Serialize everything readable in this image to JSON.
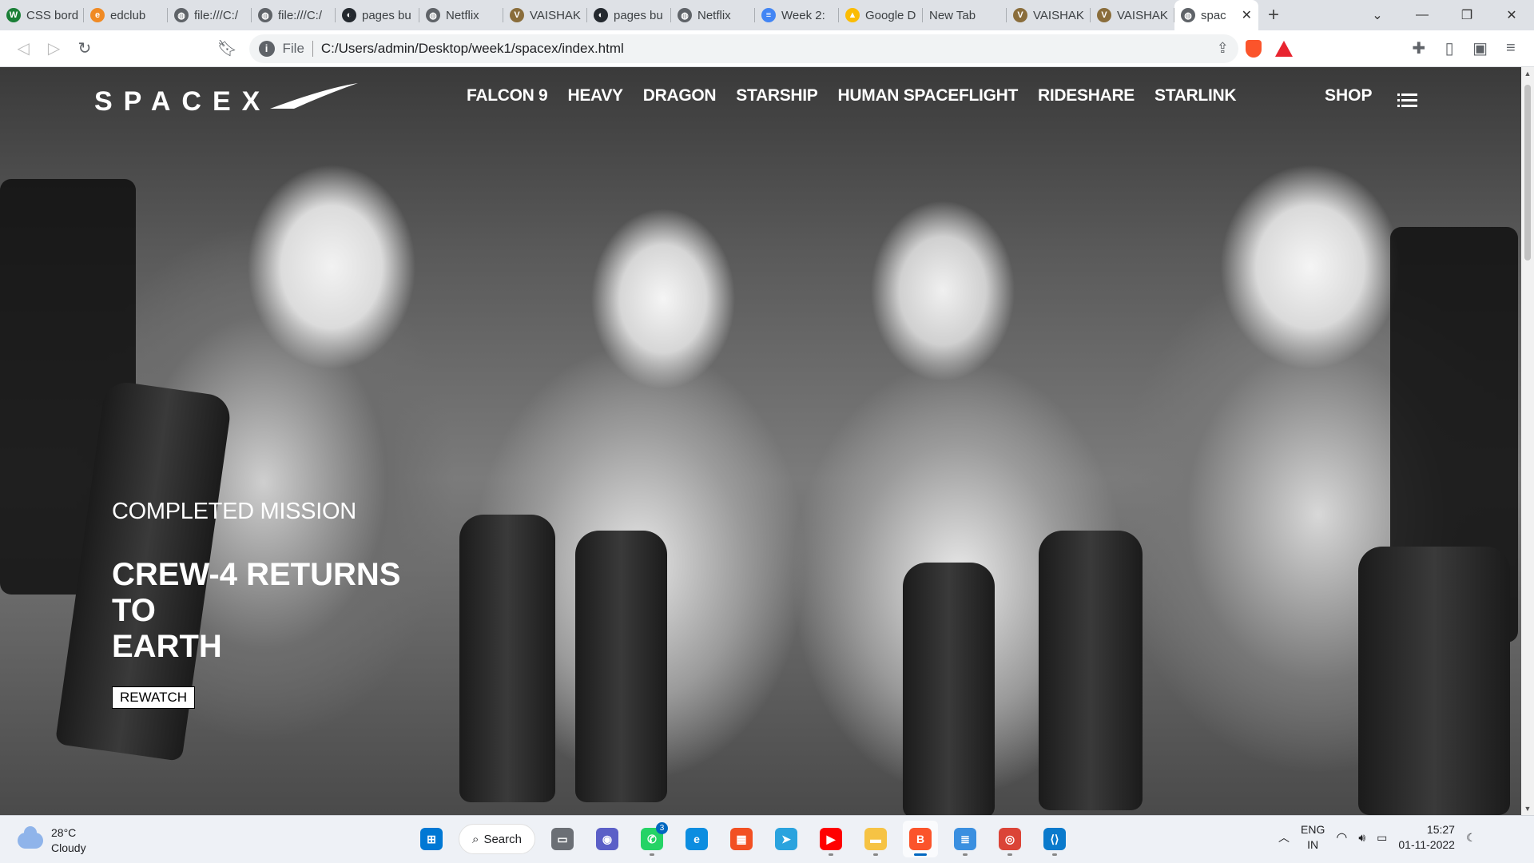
{
  "browser": {
    "tabs": [
      {
        "title": "CSS bord",
        "icon": "w-icon",
        "color": "#1a7f37",
        "glyph": "W"
      },
      {
        "title": "edclub",
        "icon": "edclub-icon",
        "color": "#f08a24",
        "glyph": "e"
      },
      {
        "title": "file:///C:/",
        "icon": "globe-icon",
        "color": "#5f6368",
        "glyph": "◍"
      },
      {
        "title": "file:///C:/",
        "icon": "globe-icon",
        "color": "#5f6368",
        "glyph": "◍"
      },
      {
        "title": "pages bu",
        "icon": "github-icon",
        "color": "#24292f",
        "glyph": "◐"
      },
      {
        "title": "Netflix",
        "icon": "globe-icon",
        "color": "#5f6368",
        "glyph": "◍"
      },
      {
        "title": "VAISHAK",
        "icon": "avatar-icon",
        "color": "#8a6d3b",
        "glyph": "V"
      },
      {
        "title": "pages bu",
        "icon": "github-icon",
        "color": "#24292f",
        "glyph": "◐"
      },
      {
        "title": "Netflix",
        "icon": "globe-icon",
        "color": "#5f6368",
        "glyph": "◍"
      },
      {
        "title": "Week 2:",
        "icon": "docs-icon",
        "color": "#4285f4",
        "glyph": "≡"
      },
      {
        "title": "Google D",
        "icon": "drive-icon",
        "color": "#fbbc04",
        "glyph": "▲"
      },
      {
        "title": "New Tab",
        "icon": "none",
        "color": "#dee1e6",
        "glyph": ""
      },
      {
        "title": "VAISHAK",
        "icon": "avatar-icon",
        "color": "#8a6d3b",
        "glyph": "V"
      },
      {
        "title": "VAISHAK",
        "icon": "avatar-icon",
        "color": "#8a6d3b",
        "glyph": "V"
      },
      {
        "title": "spac",
        "icon": "globe-icon",
        "color": "#5f6368",
        "glyph": "◍",
        "active": true
      }
    ],
    "address": {
      "scheme": "File",
      "url": "C:/Users/admin/Desktop/week1/spacex/index.html"
    }
  },
  "site": {
    "logo": "SPACEX",
    "nav": [
      "FALCON 9",
      "HEAVY",
      "DRAGON",
      "STARSHIP",
      "HUMAN SPACEFLIGHT",
      "RIDESHARE",
      "STARLINK"
    ],
    "shop": "SHOP",
    "hero": {
      "eyebrow": "COMPLETED MISSION",
      "title_lines": [
        "CREW-4 RETURNS",
        "TO",
        "EARTH"
      ],
      "cta": "REWATCH"
    }
  },
  "taskbar": {
    "weather": {
      "temp": "28°C",
      "condition": "Cloudy"
    },
    "search_label": "Search",
    "apps": [
      {
        "name": "start-button",
        "icon": "windows-icon",
        "color": "#0078d4",
        "glyph": "⊞"
      },
      {
        "name": "search"
      },
      {
        "name": "task-view-button",
        "icon": "task-view-icon",
        "color": "#6b6f75",
        "glyph": "▭"
      },
      {
        "name": "teams-button",
        "icon": "teams-icon",
        "color": "#5b5fc7",
        "glyph": "◉"
      },
      {
        "name": "whatsapp-button",
        "icon": "whatsapp-icon",
        "color": "#25d366",
        "glyph": "✆",
        "badge": "3",
        "running": true
      },
      {
        "name": "edge-button",
        "icon": "edge-icon",
        "color": "#0c8de0",
        "glyph": "e"
      },
      {
        "name": "store-button",
        "icon": "store-icon",
        "color": "#f25022",
        "glyph": "▦"
      },
      {
        "name": "telegram-button",
        "icon": "telegram-icon",
        "color": "#2aa3de",
        "glyph": "➤"
      },
      {
        "name": "youtube-button",
        "icon": "youtube-icon",
        "color": "#ff0000",
        "glyph": "▶",
        "running": true
      },
      {
        "name": "explorer-button",
        "icon": "folder-icon",
        "color": "#f6c344",
        "glyph": "▬",
        "running": true
      },
      {
        "name": "brave-button",
        "icon": "brave-icon",
        "color": "#fb542b",
        "glyph": "B",
        "running": true,
        "active": true
      },
      {
        "name": "notepad-button",
        "icon": "notepad-icon",
        "color": "#3a8fe0",
        "glyph": "≣",
        "running": true
      },
      {
        "name": "chrome-button",
        "icon": "chrome-icon",
        "color": "#db4437",
        "glyph": "◎",
        "running": true
      },
      {
        "name": "vscode-button",
        "icon": "vscode-icon",
        "color": "#0a7acc",
        "glyph": "⟨⟩",
        "running": true
      }
    ],
    "tray": {
      "lang": "ENG",
      "region": "IN",
      "time": "15:27",
      "date": "01-11-2022"
    }
  }
}
